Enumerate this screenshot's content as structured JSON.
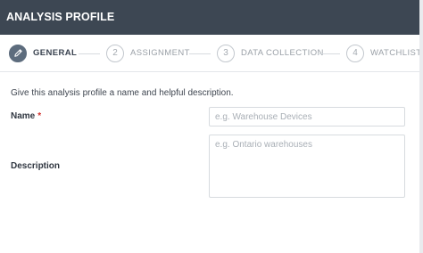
{
  "header": {
    "title": "ANALYSIS PROFILE"
  },
  "steps": [
    {
      "number": "",
      "label": "GENERAL",
      "active": true
    },
    {
      "number": "2",
      "label": "ASSIGNMENT",
      "active": false
    },
    {
      "number": "3",
      "label": "DATA COLLECTION",
      "active": false
    },
    {
      "number": "4",
      "label": "WATCHLIST",
      "active": false
    }
  ],
  "form": {
    "intro": "Give this analysis profile a name and helpful description.",
    "name_label": "Name",
    "required_mark": "*",
    "name_value": "",
    "name_placeholder": "e.g. Warehouse Devices",
    "description_label": "Description",
    "description_value": "",
    "description_placeholder": "e.g. Ontario warehouses"
  },
  "colors": {
    "header_bg": "#3d4753",
    "active_step": "#5d6c7d",
    "required": "#d0312d"
  },
  "icons": {
    "general_step": "pencil-icon"
  }
}
